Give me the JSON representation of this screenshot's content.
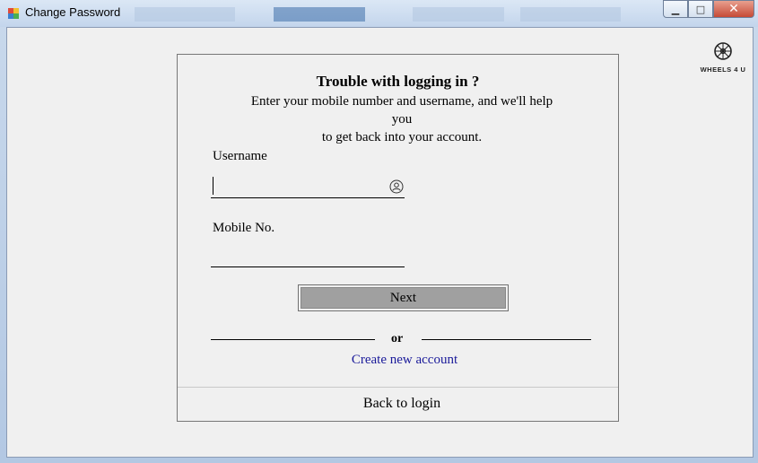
{
  "window": {
    "title": "Change Password",
    "minimize_glyph": "▁",
    "maximize_glyph": "□",
    "close_glyph": "✕"
  },
  "logo": {
    "text": "WHEELS 4 U",
    "icon": "wheel-icon"
  },
  "form": {
    "heading": "Trouble with logging in ?",
    "description_line1": "Enter your mobile number and username, and we'll help you",
    "description_line2": "to get back into your account.",
    "username_label": "Username",
    "username_value": "",
    "mobile_label": "Mobile No.",
    "mobile_value": "",
    "next_label": "Next",
    "or_label": "or",
    "create_account_label": "Create new account",
    "back_to_login_label": "Back to login"
  },
  "colors": {
    "link": "#1a1a9a",
    "button_fill": "#a0a0a0",
    "background": "#f0f0f0"
  }
}
